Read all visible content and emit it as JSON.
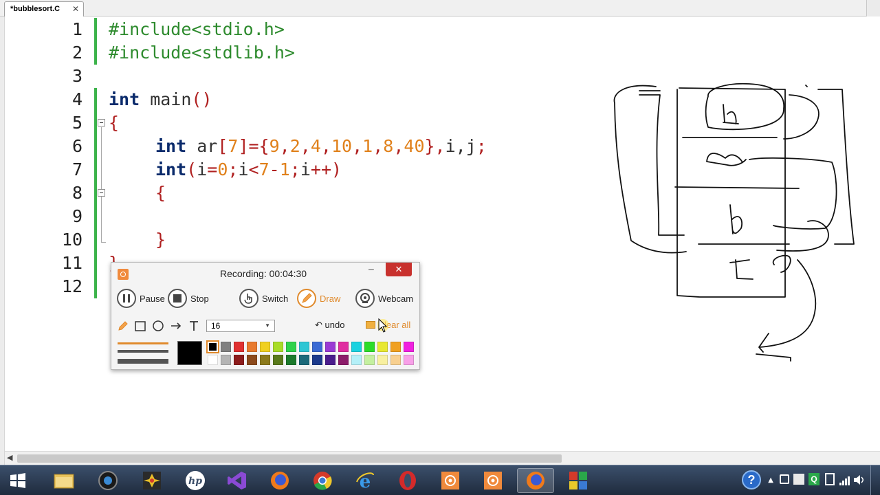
{
  "editor": {
    "tab_label": "*bubblesort.C",
    "tab_close": "✕",
    "line_numbers": [
      "1",
      "2",
      "3",
      "4",
      "5",
      "6",
      "7",
      "8",
      "9",
      "10",
      "11",
      "12"
    ],
    "code": {
      "line1": "#include<stdio.h>",
      "line2": "#include<stdlib.h>",
      "line4_kw": "int",
      "line4_rest": " main",
      "line4_paren": "()",
      "line5": "{",
      "line6_kw": "int",
      "line6_ar": " ar",
      "line6_b1": "[",
      "line6_n1": "7",
      "line6_b2": "]={",
      "line6_vals": [
        "9",
        "2",
        "4",
        "10",
        "1",
        "8",
        "40"
      ],
      "line6_b3": "},",
      "line6_tail": "i,j",
      "line6_semi": ";",
      "line7_kw": "int",
      "line7_p1": "(",
      "line7_i1": "i",
      "line7_eq": "=",
      "line7_zero": "0",
      "line7_s1": ";",
      "line7_i2": "i",
      "line7_lt": "<",
      "line7_seven": "7",
      "line7_minus": "-",
      "line7_one": "1",
      "line7_s2": ";",
      "line7_i3": "i",
      "line7_pp": "++)",
      "line8": "{",
      "line10": "}",
      "line11": "}"
    }
  },
  "recorder": {
    "status_label": "Recording:",
    "time": "00:04:30",
    "min_label": "–",
    "close_label": "✕",
    "buttons": {
      "pause": "Pause",
      "stop": "Stop",
      "switch": "Switch",
      "draw": "Draw",
      "webcam": "Webcam"
    },
    "size_value": "16",
    "undo": "undo",
    "clear_all": "Clear all",
    "current_color": "#000000",
    "palette_top": [
      "#000000",
      "#7f7f7f",
      "#e03030",
      "#e87a2e",
      "#f0d020",
      "#a8dc28",
      "#2ed24a",
      "#2ec6d4",
      "#3a6ad4",
      "#9a3ad4",
      "#e02ca0",
      "#1ad2e0",
      "#2cdc28",
      "#e8e830",
      "#f0a020",
      "#f020e0"
    ],
    "palette_bottom": [
      "#ffffff",
      "#b4b4b4",
      "#8c1c1c",
      "#8c4a1c",
      "#8c7a1c",
      "#5a7a1c",
      "#1c7a2c",
      "#1c6a7a",
      "#1c3a8c",
      "#4a1c8c",
      "#8c1c6a",
      "#b4f0f8",
      "#c4f0a0",
      "#f8f0a0",
      "#f8d090",
      "#f8a0e8"
    ]
  },
  "taskbar": {
    "apps": [
      "start-button",
      "explorer-icon",
      "webcam-app-icon",
      "photos-app-icon",
      "hp-icon",
      "visual-studio-icon",
      "firefox-icon",
      "chrome-icon",
      "ie-icon",
      "opera-icon",
      "recorder-app-icon",
      "recorder-app-icon-2",
      "firefox-active-icon",
      "codeblocks-icon"
    ],
    "help_label": "?"
  }
}
